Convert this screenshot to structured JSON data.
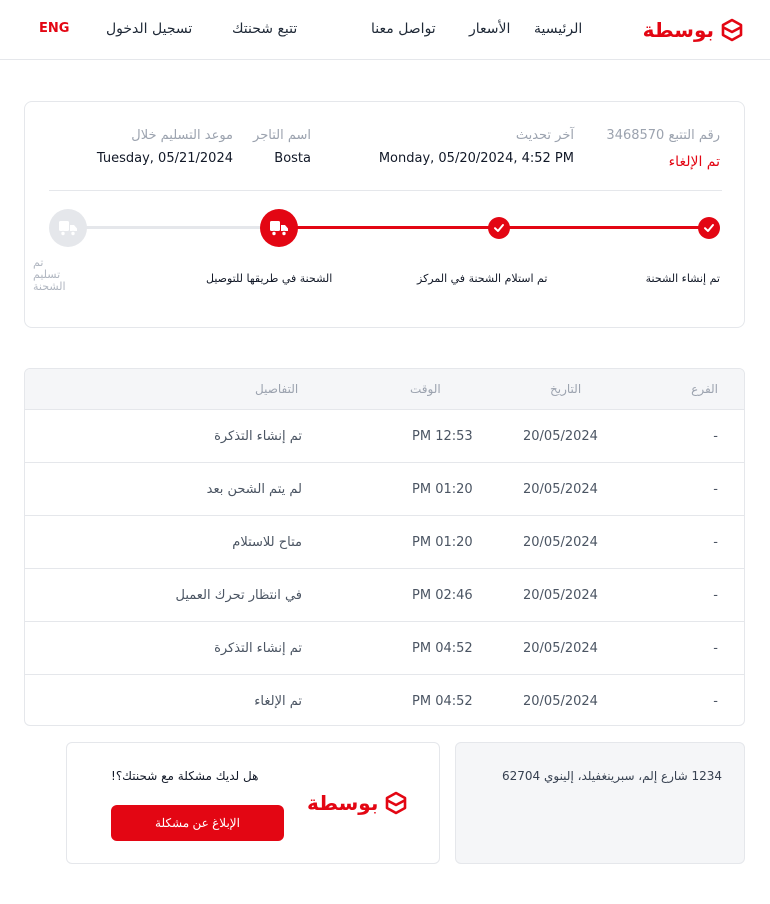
{
  "header": {
    "nav": {
      "home": "الرئيسية",
      "pricing": "الأسعار",
      "contact": "تواصل معنا",
      "track": "تتبع شحنتك",
      "login": "تسجيل الدخول",
      "language": "ENG"
    },
    "logo_text": "بوسطة"
  },
  "tracking": {
    "tracking_number_label": "رقم التتبع 3468570",
    "status": "تم الإلغاء",
    "last_update_label": "آخر تحديث",
    "last_update_value": "Monday, 05/20/2024, 4:52 PM",
    "merchant_label": "اسم التاجر",
    "merchant_value": "Bosta",
    "delivery_label": "موعد التسليم خلال",
    "delivery_value": "Tuesday, 05/21/2024",
    "steps": [
      {
        "label": "تم إنشاء الشحنة",
        "state": "done"
      },
      {
        "label": "تم استلام الشحنة في المركز",
        "state": "done"
      },
      {
        "label": "الشحنة في طريقها للتوصيل",
        "state": "current"
      },
      {
        "label": "تم تسليم الشحنة",
        "state": "pending"
      }
    ],
    "icons": {
      "done": "check-icon",
      "current": "truck-icon",
      "pending": "truck-icon"
    }
  },
  "history": {
    "headers": {
      "branch": "الفرع",
      "date": "التاريخ",
      "time": "الوقت",
      "details": "التفاصيل"
    },
    "rows": [
      {
        "branch": "-",
        "date": "20/05/2024",
        "time": "PM 12:53",
        "details": "تم إنشاء التذكرة"
      },
      {
        "branch": "-",
        "date": "20/05/2024",
        "time": "PM 01:20",
        "details": "لم يتم الشحن بعد"
      },
      {
        "branch": "-",
        "date": "20/05/2024",
        "time": "PM 01:20",
        "details": "متاح للاستلام"
      },
      {
        "branch": "-",
        "date": "20/05/2024",
        "time": "PM 02:46",
        "details": "في انتظار تحرك العميل"
      },
      {
        "branch": "-",
        "date": "20/05/2024",
        "time": "PM 04:52",
        "details": "تم إنشاء التذكرة"
      },
      {
        "branch": "-",
        "date": "20/05/2024",
        "time": "PM 04:52",
        "details": "تم الإلغاء"
      }
    ]
  },
  "footer": {
    "address": "1234 شارع إلم، سبرينغفيلد، إلينوي 62704",
    "report_question": "!هل لديك مشكلة مع شحنتك؟",
    "report_button": "الإبلاغ عن مشكلة",
    "logo_text": "بوسطة"
  },
  "colors": {
    "brand": "#e30613",
    "muted": "#9ca3af",
    "pending": "#d1d5db"
  }
}
